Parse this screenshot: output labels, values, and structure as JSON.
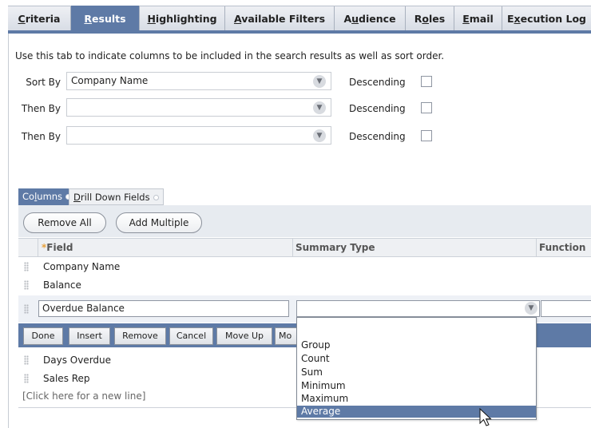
{
  "tabs": [
    {
      "accel": "C",
      "rest": "riteria",
      "active": false
    },
    {
      "accel": "R",
      "rest": "esults",
      "active": true
    },
    {
      "accel": "H",
      "rest": "ighlighting",
      "active": false
    },
    {
      "accel": "A",
      "rest": "vailable Filters",
      "active": false
    },
    {
      "pre": "A",
      "accel": "u",
      "rest": "dience",
      "active": false
    },
    {
      "pre": "R",
      "accel": "o",
      "rest": "les",
      "active": false
    },
    {
      "accel": "E",
      "rest": "mail",
      "active": false
    },
    {
      "pre": "E",
      "accel": "x",
      "rest": "ecution Log",
      "active": false
    }
  ],
  "intro": "Use this tab to indicate columns to be included in the search results as well as sort order.",
  "sort": {
    "rows": [
      {
        "label": "Sort By",
        "value": "Company Name",
        "descending_label": "Descending",
        "checked": false
      },
      {
        "label": "Then By",
        "value": "",
        "descending_label": "Descending",
        "checked": false
      },
      {
        "label": "Then By",
        "value": "",
        "descending_label": "Descending",
        "checked": false
      }
    ]
  },
  "subtabs": {
    "columns_pre": "Co",
    "columns_accel": "l",
    "columns_rest": "umns",
    "drill_accel": "D",
    "drill_rest": "rill Down Fields"
  },
  "buttons": {
    "remove_all": "Remove All",
    "add_multiple": "Add Multiple"
  },
  "grid": {
    "headers": {
      "field": "Field",
      "summary": "Summary Type",
      "function": "Function"
    },
    "required_marker": "*",
    "rows_top": [
      "Company Name",
      "Balance"
    ],
    "edit_row": {
      "field": "Overdue Balance",
      "summary": ""
    },
    "rows_bottom": [
      "Days Overdue",
      "Sales Rep"
    ],
    "new_line": "[Click here for a new line]"
  },
  "actions": [
    "Done",
    "Insert",
    "Remove",
    "Cancel",
    "Move Up",
    "Mo"
  ],
  "summary_options": [
    "Group",
    "Count",
    "Sum",
    "Minimum",
    "Maximum",
    "Average"
  ],
  "summary_selected": "Average",
  "colors": {
    "accent": "#5e7aa6",
    "required": "#e8a23d"
  }
}
